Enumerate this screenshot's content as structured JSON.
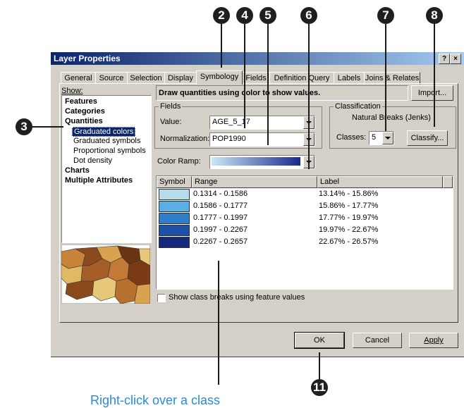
{
  "dialog": {
    "title": "Layer Properties",
    "help_label": "?",
    "close_label": "×",
    "tabs": [
      "General",
      "Source",
      "Selection",
      "Display",
      "Symbology",
      "Fields",
      "Definition Query",
      "Labels",
      "Joins & Relates"
    ],
    "active_tab": "Symbology"
  },
  "show": {
    "label": "Show:",
    "items": [
      {
        "label": "Features"
      },
      {
        "label": "Categories"
      },
      {
        "label": "Quantities"
      },
      {
        "label": "Graduated colors"
      },
      {
        "label": "Graduated symbols"
      },
      {
        "label": "Proportional symbols"
      },
      {
        "label": "Dot density"
      },
      {
        "label": "Charts"
      },
      {
        "label": "Multiple Attributes"
      }
    ],
    "selected": "Graduated colors"
  },
  "description": "Draw quantities using color to show values.",
  "import_button": "Import...",
  "fields": {
    "group_label": "Fields",
    "value_label": "Value:",
    "value": "AGE_5_17",
    "normalization_label": "Normalization:",
    "normalization": "POP1990"
  },
  "classification": {
    "group_label": "Classification",
    "method": "Natural Breaks (Jenks)",
    "classes_label": "Classes:",
    "classes": "5",
    "classify_button": "Classify..."
  },
  "color_ramp": {
    "label": "Color Ramp:",
    "from": "#c9e7f5",
    "to": "#1a2a8c"
  },
  "table": {
    "headers": [
      "Symbol",
      "Range",
      "Label"
    ],
    "rows": [
      {
        "color": "#b4dcea",
        "range": "0.1314 - 0.1586",
        "label": "13.14% - 15.86%"
      },
      {
        "color": "#5aaee4",
        "range": "0.1586 - 0.1777",
        "label": "15.86% - 17.77%"
      },
      {
        "color": "#2f7cc8",
        "range": "0.1777 - 0.1997",
        "label": "17.77% - 19.97%"
      },
      {
        "color": "#1d4fa6",
        "range": "0.1997 - 0.2267",
        "label": "19.97% - 22.67%"
      },
      {
        "color": "#14287c",
        "range": "0.2267 - 0.2657",
        "label": "22.67% - 26.57%"
      }
    ]
  },
  "class_breaks_checkbox": "Show class breaks using feature values",
  "buttons": {
    "ok": "OK",
    "cancel": "Cancel",
    "apply": "Apply"
  },
  "callouts": [
    "2",
    "4",
    "5",
    "6",
    "7",
    "8",
    "3",
    "11"
  ],
  "caption": "Right-click over a class"
}
